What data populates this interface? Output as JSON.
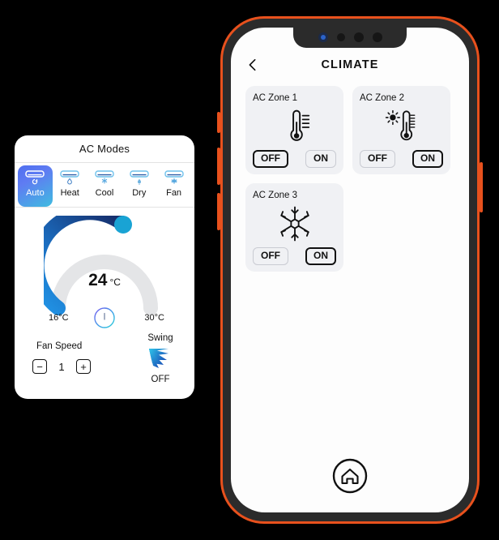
{
  "ac_panel": {
    "title": "AC Modes",
    "modes": [
      {
        "label": "Auto",
        "icon": "ac-unit-auto-icon",
        "active": true
      },
      {
        "label": "Heat",
        "icon": "ac-unit-heat-icon",
        "active": false
      },
      {
        "label": "Cool",
        "icon": "ac-unit-cool-icon",
        "active": false
      },
      {
        "label": "Dry",
        "icon": "ac-unit-dry-icon",
        "active": false
      },
      {
        "label": "Fan",
        "icon": "ac-unit-fan-icon",
        "active": false
      }
    ],
    "dial": {
      "temperature": "24",
      "unit": "°C",
      "min_label": "16°C",
      "max_label": "30°C",
      "min_value": 16,
      "max_value": 30,
      "current_value": 24,
      "track_color": "#e4e5e7",
      "fill_gradient_start": "#2196e8",
      "fill_gradient_end": "#16306e",
      "thumb_color": "#19a3d4",
      "power_icon": "power-icon"
    },
    "fan_speed": {
      "label": "Fan Speed",
      "value": "1",
      "decrement_label": "−",
      "increment_label": "+"
    },
    "swing": {
      "label": "Swing",
      "state": "OFF",
      "icon": "swing-blades-icon"
    }
  },
  "phone": {
    "frame_color": "#e8511d",
    "header": {
      "back_icon": "back-chevron-icon",
      "title": "CLIMATE"
    },
    "zones": [
      {
        "title": "AC Zone 1",
        "icon": "thermometer-heat-icon",
        "off_label": "OFF",
        "on_label": "ON",
        "selected": "OFF"
      },
      {
        "title": "AC Zone 2",
        "icon": "thermometer-sun-icon",
        "off_label": "OFF",
        "on_label": "ON",
        "selected": "ON"
      },
      {
        "title": "AC Zone 3",
        "icon": "snowflake-icon",
        "off_label": "OFF",
        "on_label": "ON",
        "selected": "ON"
      }
    ],
    "home_button_icon": "home-icon"
  }
}
